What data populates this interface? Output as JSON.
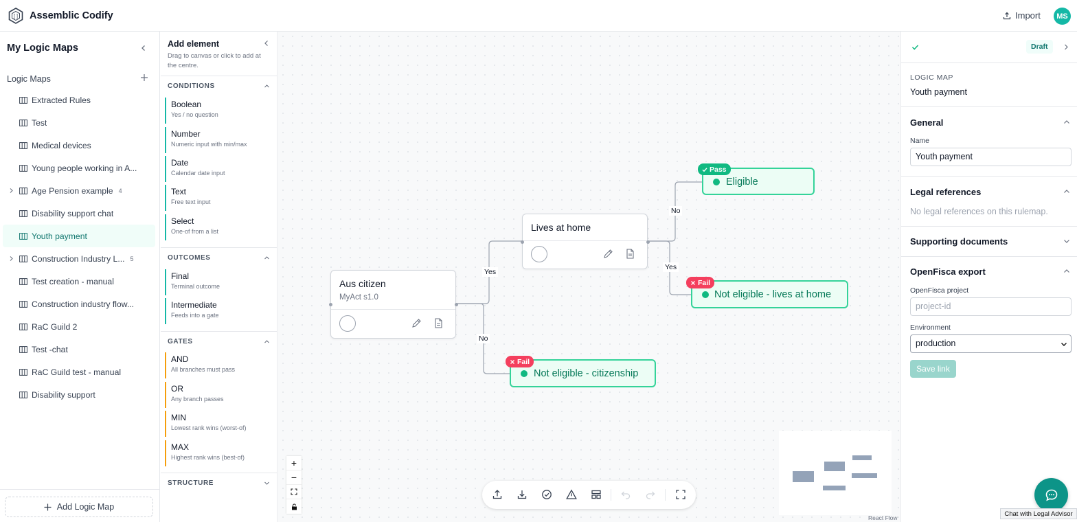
{
  "app": {
    "title": "Assemblic Codify",
    "import_label": "Import",
    "avatar_initials": "MS"
  },
  "sidebar": {
    "title": "My Logic Maps",
    "section_label": "Logic Maps",
    "items": [
      {
        "label": "Extracted Rules"
      },
      {
        "label": "Test"
      },
      {
        "label": "Medical devices"
      },
      {
        "label": "Young people working in A..."
      },
      {
        "label": "Age Pension example",
        "count": "4",
        "expandable": true
      },
      {
        "label": "Disability support chat"
      },
      {
        "label": "Youth payment",
        "active": true
      },
      {
        "label": "Construction Industry L...",
        "count": "5",
        "expandable": true
      },
      {
        "label": "Test creation - manual"
      },
      {
        "label": "Construction industry flow..."
      },
      {
        "label": "RaC Guild 2"
      },
      {
        "label": "Test -chat"
      },
      {
        "label": "RaC Guild test - manual"
      },
      {
        "label": "Disability support"
      }
    ],
    "add_label": "Add Logic Map"
  },
  "palette": {
    "title": "Add element",
    "subtitle": "Drag to canvas or click to add at the centre.",
    "sections": {
      "conditions": {
        "label": "CONDITIONS",
        "items": [
          {
            "name": "Boolean",
            "desc": "Yes / no question"
          },
          {
            "name": "Number",
            "desc": "Numeric input with min/max"
          },
          {
            "name": "Date",
            "desc": "Calendar date input"
          },
          {
            "name": "Text",
            "desc": "Free text input"
          },
          {
            "name": "Select",
            "desc": "One-of from a list"
          }
        ]
      },
      "outcomes": {
        "label": "OUTCOMES",
        "items": [
          {
            "name": "Final",
            "desc": "Terminal outcome"
          },
          {
            "name": "Intermediate",
            "desc": "Feeds into a gate"
          }
        ]
      },
      "gates": {
        "label": "GATES",
        "items": [
          {
            "name": "AND",
            "desc": "All branches must pass"
          },
          {
            "name": "OR",
            "desc": "Any branch passes"
          },
          {
            "name": "MIN",
            "desc": "Lowest rank wins (worst-of)"
          },
          {
            "name": "MAX",
            "desc": "Highest rank wins (best-of)"
          }
        ]
      },
      "structure": {
        "label": "STRUCTURE"
      }
    }
  },
  "canvas": {
    "nodes": {
      "aus_citizen": {
        "title": "Aus citizen",
        "subtitle": "MyAct s1.0"
      },
      "lives_at_home": {
        "title": "Lives at home"
      }
    },
    "outcomes": {
      "eligible": {
        "label": "Eligible",
        "tag": "Pass"
      },
      "not_eligible_home": {
        "label": "Not eligible - lives at home",
        "tag": "Fail"
      },
      "not_eligible_citizenship": {
        "label": "Not eligible - citizenship",
        "tag": "Fail"
      }
    },
    "edge_labels": {
      "yes1": "Yes",
      "no1": "No",
      "no2": "No",
      "yes2": "Yes"
    },
    "zoom": {
      "in": "+",
      "out": "−"
    },
    "attribution": "React Flow"
  },
  "right_panel": {
    "status": "Draft",
    "logic_map_caption": "LOGIC MAP",
    "logic_map_name": "Youth payment",
    "general": {
      "heading": "General",
      "name_label": "Name",
      "name_value": "Youth payment"
    },
    "legal": {
      "heading": "Legal references",
      "empty": "No legal references on this rulemap."
    },
    "supporting": {
      "heading": "Supporting documents"
    },
    "openfisca": {
      "heading": "OpenFisca export",
      "project_label": "OpenFisca project",
      "project_placeholder": "project-id",
      "env_label": "Environment",
      "env_value": "production",
      "save_label": "Save link"
    }
  },
  "chat": {
    "tooltip": "Chat with Legal Advisor"
  },
  "colors": {
    "accent": "#14b8a6",
    "pass": "#10b981",
    "fail": "#f43f5e",
    "gate": "#f59e0b"
  }
}
